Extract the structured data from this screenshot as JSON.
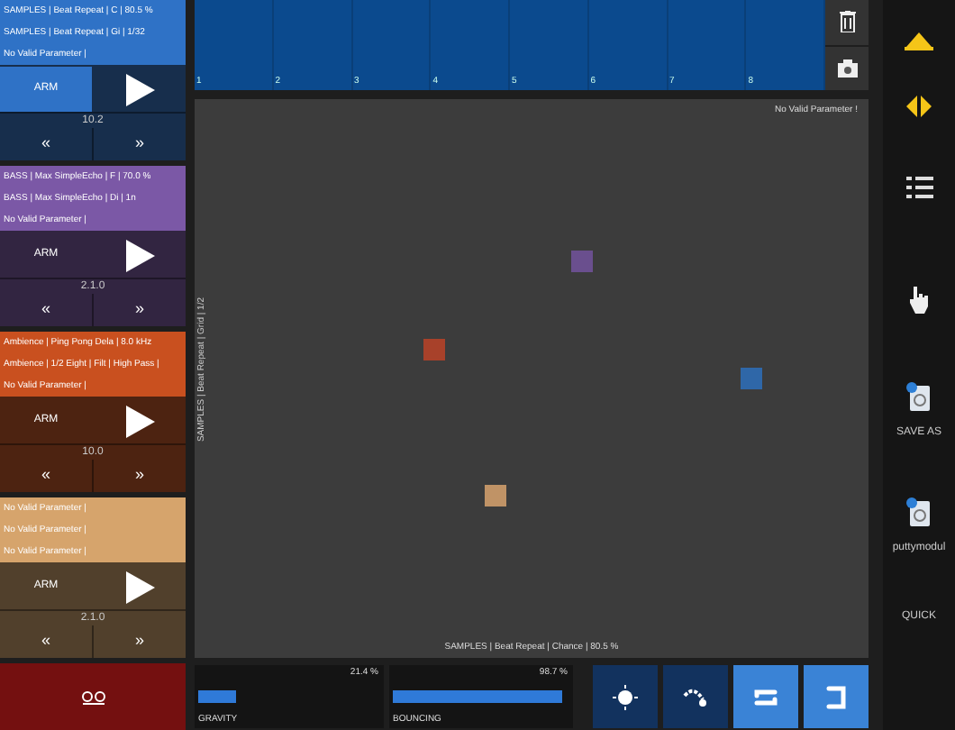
{
  "channels": [
    {
      "color": "#2f72c6",
      "lines": [
        "SAMPLES | Beat Repeat | C | 80.5 %",
        "SAMPLES | Beat Repeat | Gi | 1/32",
        "No Valid Parameter |"
      ],
      "arm": {
        "label": "ARM",
        "selected": true
      },
      "counter": "10.2",
      "prev": "«",
      "next": "»"
    },
    {
      "color": "#7b58a6",
      "lines": [
        "BASS | Max SimpleEcho | F | 70.0 %",
        "BASS | Max SimpleEcho | Di | 1n",
        "No Valid Parameter |"
      ],
      "arm": {
        "label": "ARM",
        "selected": false
      },
      "counter": "2.1.0",
      "prev": "«",
      "next": "»"
    },
    {
      "color": "#c9501f",
      "lines": [
        "Ambience | Ping Pong Dela | 8.0 kHz",
        "Ambience | 1/2 Eight | Filt | High Pass |",
        "No Valid Parameter |"
      ],
      "arm": {
        "label": "ARM",
        "selected": false
      },
      "counter": "10.0",
      "prev": "«",
      "next": "»"
    },
    {
      "color": "#d6a46c",
      "lines": [
        "No Valid Parameter |",
        "No Valid Parameter |",
        "No Valid Parameter |"
      ],
      "arm": {
        "label": "ARM",
        "selected": false
      },
      "counter": "2.1.0",
      "prev": "«",
      "next": "»"
    }
  ],
  "pads": [
    "1",
    "2",
    "3",
    "4",
    "5",
    "6",
    "7",
    "8"
  ],
  "xy_pad": {
    "top_label": "No Valid Parameter !",
    "y_label": "SAMPLES | Beat Repeat | Grid | 1/2",
    "x_label": "SAMPLES | Beat Repeat | Chance | 80.5 %",
    "cubes": [
      {
        "color": "#6a4f8e"
      },
      {
        "color": "#a8412a"
      },
      {
        "color": "#2f67a8"
      },
      {
        "color": "#c09366"
      }
    ]
  },
  "sliders": [
    {
      "label": "GRAVITY",
      "reading": "21.4 %",
      "level": 0.21
    },
    {
      "label": "BOUNCING",
      "reading": "98.7 %",
      "level": 0.98
    }
  ],
  "modes": [
    {
      "kind": "sun",
      "selected": false
    },
    {
      "kind": "curve",
      "selected": false
    },
    {
      "kind": "loop",
      "selected": true
    },
    {
      "kind": "return",
      "selected": true
    }
  ],
  "sidebar": [
    {
      "kind": "up"
    },
    {
      "kind": "leftright"
    },
    {
      "kind": "list"
    },
    {
      "kind": "hand"
    },
    {
      "kind": "file",
      "label": "SAVE AS"
    },
    {
      "kind": "file",
      "label": "puttymodul"
    },
    {
      "kind": "text",
      "label": "QUICK"
    }
  ]
}
